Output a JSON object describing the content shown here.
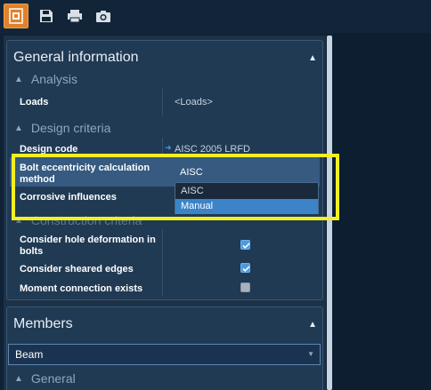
{
  "toolbar": {
    "buttons": [
      {
        "icon": "connection-icon",
        "active": true
      },
      {
        "icon": "save-icon"
      },
      {
        "icon": "print-icon"
      },
      {
        "icon": "camera-icon"
      }
    ]
  },
  "general": {
    "title": "General information",
    "analysis": {
      "group_label": "Analysis",
      "loads_label": "Loads",
      "loads_value": "<Loads>"
    },
    "design": {
      "group_label": "Design criteria",
      "design_code_label": "Design code",
      "design_code_value": "AISC 2005 LRFD",
      "bolt_label_line1": "Bolt eccentricity calculation",
      "bolt_label_line2": "method",
      "bolt_value": "AISC",
      "corrosive_label": "Corrosive influences",
      "dropdown_options": [
        "AISC",
        "Manual"
      ],
      "dropdown_selected": "Manual"
    },
    "construction": {
      "group_label": "Construction criteria",
      "hole_label_line1": "Consider hole deformation in",
      "hole_label_line2": "bolts",
      "hole_checked": true,
      "sheared_label": "Consider sheared edges",
      "sheared_checked": true,
      "moment_label": "Moment connection exists",
      "moment_checked": false
    }
  },
  "members": {
    "title": "Members",
    "selected": "Beam",
    "general_label": "General"
  },
  "colors": {
    "accent": "#e0812b",
    "highlight": "#f4ef22",
    "selection": "#3c84c7"
  }
}
